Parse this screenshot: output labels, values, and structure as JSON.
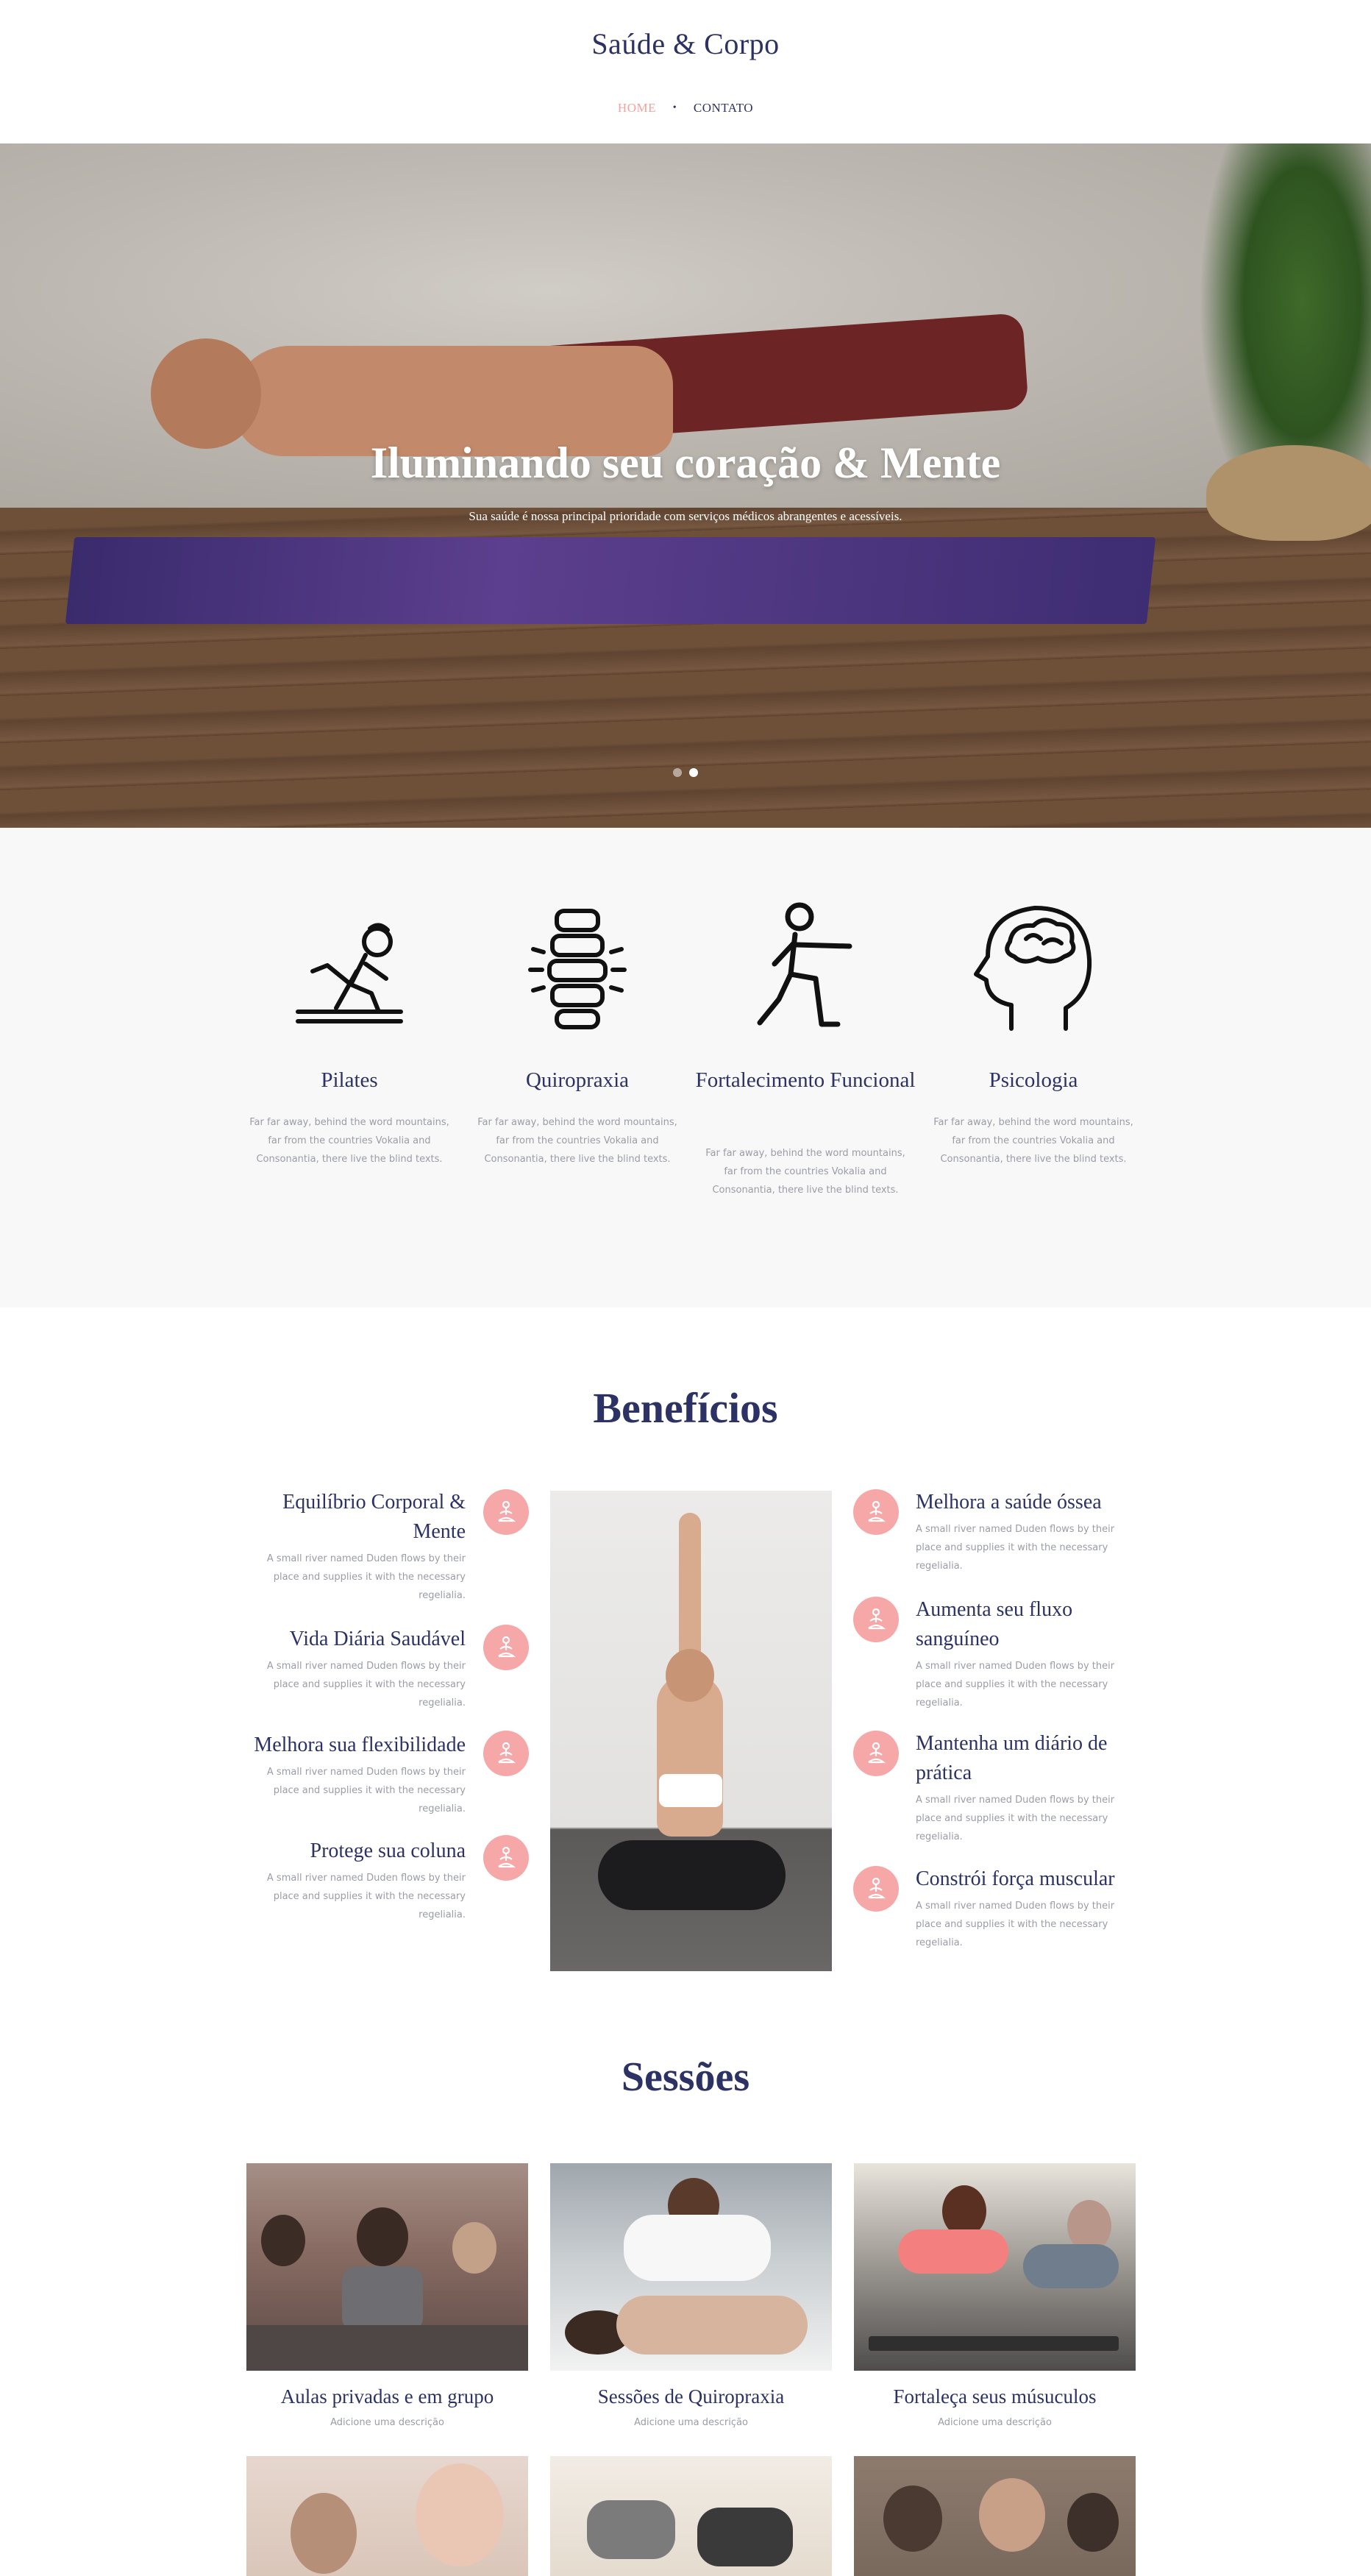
{
  "header": {
    "brand": "Saúde & Corpo",
    "nav": [
      {
        "label": "HOME",
        "active": true
      },
      {
        "label": "CONTATO",
        "active": false
      }
    ],
    "nav_separator": "•"
  },
  "hero": {
    "title": "Iluminando seu coração & Mente",
    "subtitle": "Sua saúde é nossa principal prioridade com serviços médicos abrangentes e acessíveis.",
    "slides": 2,
    "active_slide": 2
  },
  "services": [
    {
      "icon": "pilates-icon",
      "title": "Pilates",
      "text": "Far far away, behind the word mountains, far from the countries Vokalia and Consonantia, there live the blind texts."
    },
    {
      "icon": "spine-icon",
      "title": "Quiropraxia",
      "text": "Far far away, behind the word mountains, far from the countries Vokalia and Consonantia, there live the blind texts."
    },
    {
      "icon": "lunge-icon",
      "title": "Fortalecimento Funcional",
      "text": "Far far away, behind the word mountains, far from the countries Vokalia and Consonantia, there live the blind texts."
    },
    {
      "icon": "brain-head-icon",
      "title": "Psicologia",
      "text": "Far far away, behind the word mountains, far from the countries Vokalia and Consonantia, there live the blind texts."
    }
  ],
  "benefits": {
    "title": "Benefícios",
    "left": [
      {
        "title": "Equilíbrio Corporal & Mente",
        "text": "A small river named Duden flows by their place and supplies it with the necessary regelialia."
      },
      {
        "title": "Vida Diária Saudável",
        "text": "A small river named Duden flows by their place and supplies it with the necessary regelialia."
      },
      {
        "title": "Melhora sua flexibilidade",
        "text": "A small river named Duden flows by their place and supplies it with the necessary regelialia."
      },
      {
        "title": "Protege sua coluna",
        "text": "A small river named Duden flows by their place and supplies it with the necessary regelialia."
      }
    ],
    "right": [
      {
        "title": "Melhora a saúde óssea",
        "text": "A small river named Duden flows by their place and supplies it with the necessary regelialia."
      },
      {
        "title": "Aumenta seu fluxo sanguíneo",
        "text": "A small river named Duden flows by their place and supplies it with the necessary regelialia."
      },
      {
        "title": "Mantenha um diário de prática",
        "text": "A small river named Duden flows by their place and supplies it with the necessary regelialia."
      },
      {
        "title": "Constrói força muscular",
        "text": "A small river named Duden flows by their place and supplies it with the necessary regelialia."
      }
    ]
  },
  "sessions": {
    "title": "Sessões",
    "cards": [
      {
        "title": "Aulas privadas e em grupo",
        "desc": "Adicione uma descrição"
      },
      {
        "title": "Sessões de Quiropraxia",
        "desc": "Adicione uma descrição"
      },
      {
        "title": "Fortaleça seus músuculos",
        "desc": "Adicione uma descrição"
      }
    ]
  },
  "colors": {
    "primary": "#2c3263",
    "accent": "#f4a09f",
    "badge": "#f6a8a8",
    "muted_text": "#9a9ca8",
    "section_bg": "#f8f8f8"
  }
}
